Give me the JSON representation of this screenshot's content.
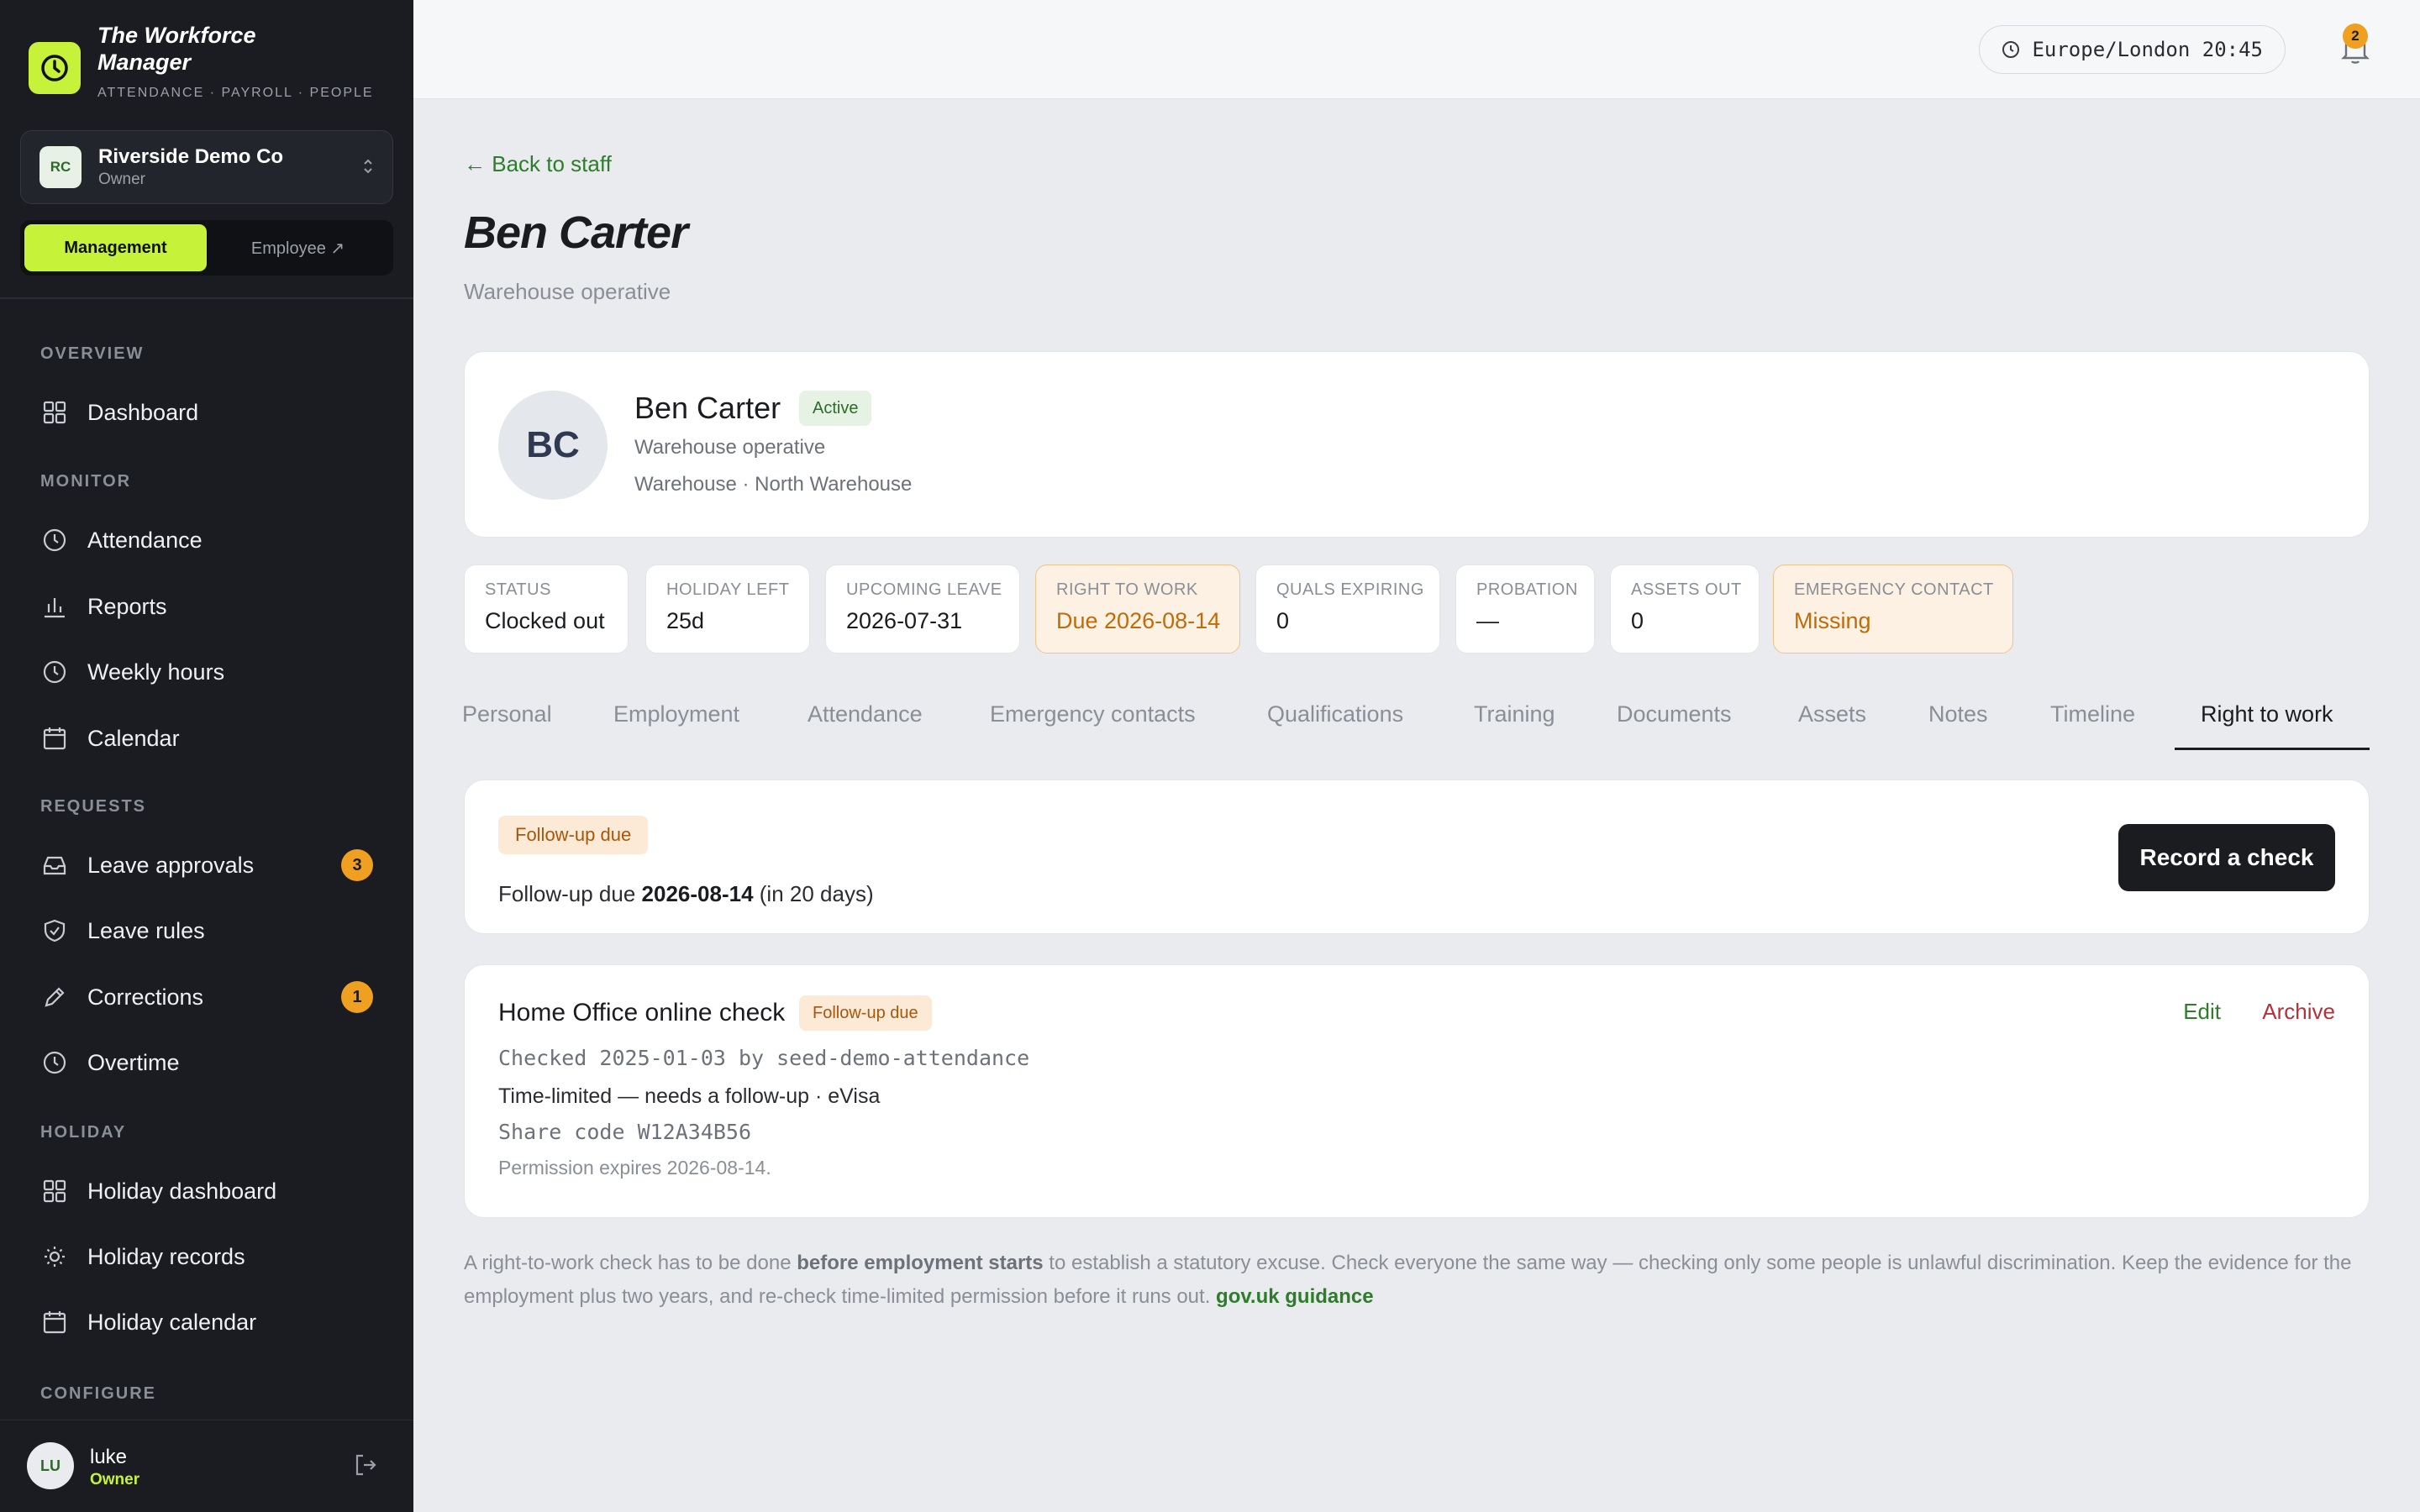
{
  "brand": {
    "name": "The Workforce Manager",
    "tagline": "ATTENDANCE · PAYROLL · PEOPLE",
    "accent": "#c6f23a"
  },
  "org": {
    "initials": "RC",
    "name": "Riverside Demo Co",
    "role": "Owner"
  },
  "mode": {
    "management": "Management",
    "employee": "Employee ↗"
  },
  "sidebar": {
    "sections": {
      "overview": "OVERVIEW",
      "monitor": "MONITOR",
      "requests": "REQUESTS",
      "holiday": "HOLIDAY",
      "configure": "CONFIGURE"
    },
    "items": {
      "dashboard": "Dashboard",
      "attendance": "Attendance",
      "reports": "Reports",
      "weekly_hours": "Weekly hours",
      "calendar": "Calendar",
      "leave_approvals": "Leave approvals",
      "leave_approvals_badge": "3",
      "leave_rules": "Leave rules",
      "corrections": "Corrections",
      "corrections_badge": "1",
      "overtime": "Overtime",
      "holiday_dashboard": "Holiday dashboard",
      "holiday_records": "Holiday records",
      "holiday_calendar": "Holiday calendar"
    }
  },
  "user": {
    "initials": "LU",
    "name": "luke",
    "role": "Owner"
  },
  "topbar": {
    "timezone": "Europe/London 20:45",
    "notifications": "2"
  },
  "page": {
    "back": "← Back to staff",
    "title": "Ben Carter",
    "subtitle": "Warehouse operative"
  },
  "profile": {
    "initials": "BC",
    "name": "Ben Carter",
    "status": "Active",
    "role": "Warehouse operative",
    "location": "Warehouse · North Warehouse"
  },
  "stats": [
    {
      "label": "STATUS",
      "value": "Clocked out"
    },
    {
      "label": "HOLIDAY LEFT",
      "value": "25d"
    },
    {
      "label": "UPCOMING LEAVE",
      "value": "2026-07-31"
    },
    {
      "label": "RIGHT TO WORK",
      "value": "Due 2026-08-14"
    },
    {
      "label": "QUALS EXPIRING",
      "value": "0"
    },
    {
      "label": "PROBATION",
      "value": "—"
    },
    {
      "label": "ASSETS OUT",
      "value": "0"
    },
    {
      "label": "EMERGENCY CONTACT",
      "value": "Missing"
    }
  ],
  "tabs": [
    "Personal",
    "Employment",
    "Attendance",
    "Emergency contacts",
    "Qualifications",
    "Training",
    "Documents",
    "Assets",
    "Notes",
    "Timeline",
    "Right to work"
  ],
  "followup": {
    "badge": "Follow-up due",
    "prefix": "Follow-up due ",
    "date": "2026-08-14",
    "suffix": " (in 20 days)",
    "button": "Record a check"
  },
  "check": {
    "title": "Home Office online check",
    "badge": "Follow-up due",
    "checked": "Checked 2025-01-03 by seed-demo-attendance",
    "type": "Time-limited — needs a follow-up · eVisa",
    "share_code": "Share code W12A34B56",
    "expiry": "Permission expires 2026-08-14.",
    "edit": "Edit",
    "archive": "Archive"
  },
  "note": {
    "part1": "A right-to-work check has to be done ",
    "bold": "before employment starts",
    "part2": " to establish a statutory excuse. Check everyone the same way — checking only some people is unlawful discrimination. Keep the evidence for the employment plus two years, and re-check time-limited permission before it runs out. ",
    "link": "gov.uk guidance"
  }
}
